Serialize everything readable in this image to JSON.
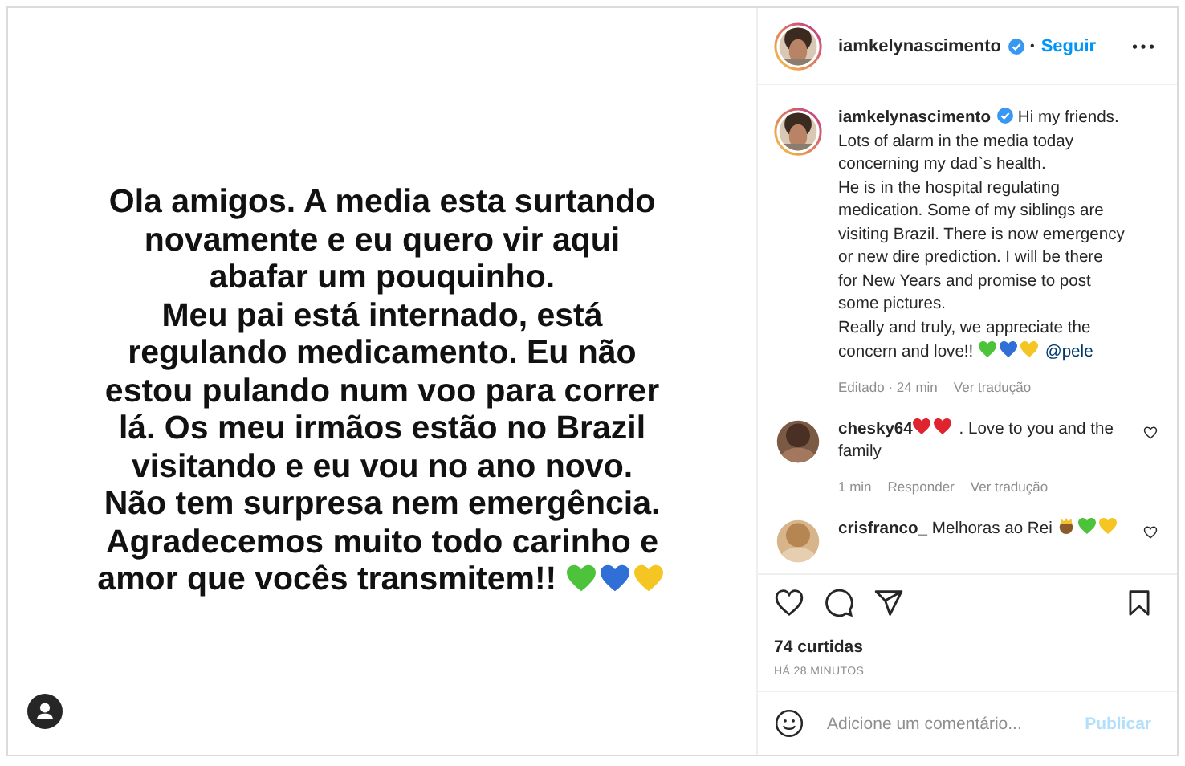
{
  "post_image": {
    "parts": [
      {
        "kind": "text",
        "text": "Ola amigos. A media esta surtando\nnovamente e eu quero vir aqui\nabafar um pouquinho.\nMeu pai está internado, está\nregulando medicamento. Eu não\nestou pulando num voo para correr\nlá. Os meu irmãos estão no Brazil\nvisitando e eu vou no ano novo.\nNão tem surpresa nem emergência.\nAgradecemos muito todo carinho e\namor que vocês transmitem!! "
      },
      {
        "kind": "heart",
        "color": "#4cc33a"
      },
      {
        "kind": "heart",
        "color": "#2f6fd6"
      },
      {
        "kind": "heart",
        "color": "#f5c623"
      }
    ]
  },
  "header": {
    "username": "iamkelynascimento",
    "verified": true,
    "separator": "•",
    "follow": "Seguir"
  },
  "caption": {
    "username": "iamkelynascimento",
    "verified": true,
    "parts": [
      {
        "kind": "text",
        "text": "Hi my friends.\nLots of alarm in the media today\nconcerning my dad`s health.\nHe is in the hospital regulating\nmedication. Some of my siblings are\nvisiting Brazil. There is now emergency\nor new dire prediction. I will be there\nfor New Years and promise to post\nsome pictures.\nReally and truly, we appreciate the\nconcern and love!! "
      },
      {
        "kind": "heart",
        "color": "#4cc33a"
      },
      {
        "kind": "heart",
        "color": "#2f6fd6"
      },
      {
        "kind": "heart",
        "color": "#f5c623"
      },
      {
        "kind": "mention",
        "text": "@pele"
      }
    ],
    "meta": [
      "Editado · 24 min",
      "Ver tradução"
    ]
  },
  "comments": [
    {
      "username": "chesky64",
      "parts": [
        {
          "kind": "heart",
          "color": "#e0242f"
        },
        {
          "kind": "heart",
          "color": "#e0242f"
        },
        {
          "kind": "text",
          "text": ". Love to you and the family"
        }
      ],
      "meta": [
        "1 min",
        "Responder",
        "Ver tradução"
      ]
    },
    {
      "username": "crisfranco_",
      "parts": [
        {
          "kind": "text",
          "text": "Melhoras ao Rei "
        },
        {
          "kind": "crown"
        },
        {
          "kind": "heart",
          "color": "#4cc33a"
        },
        {
          "kind": "heart",
          "color": "#f5c623"
        }
      ]
    }
  ],
  "likes": "74 curtidas",
  "time": "HÁ 28 MINUTOS",
  "comment_box": {
    "placeholder": "Adicione um comentário...",
    "publish": "Publicar",
    "disabled": true
  }
}
